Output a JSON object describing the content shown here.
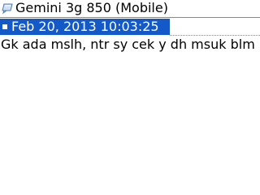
{
  "header": {
    "icon": "chat-bubble-icon",
    "contact_name": "Gemini 3g 850 (Mobile)"
  },
  "message": {
    "timestamp": "Feb 20, 2013 10:03:25",
    "text": "Gk ada mslh, ntr sy cek y dh msuk blm",
    "selected": true
  },
  "colors": {
    "highlight": "#1459c8",
    "divider": "#6e8fb8",
    "background": "#ffffff"
  }
}
